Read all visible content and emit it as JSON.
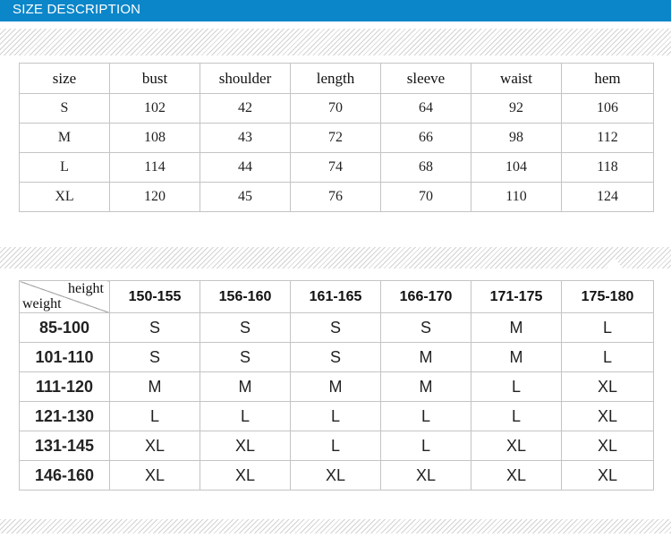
{
  "header": {
    "title": "SIZE DESCRIPTION",
    "bar_color": "#0b86c9"
  },
  "size_table": {
    "columns": [
      "size",
      "bust",
      "shoulder",
      "length",
      "sleeve",
      "waist",
      "hem"
    ],
    "rows": [
      [
        "S",
        "102",
        "42",
        "70",
        "64",
        "92",
        "106"
      ],
      [
        "M",
        "108",
        "43",
        "72",
        "66",
        "98",
        "112"
      ],
      [
        "L",
        "114",
        "44",
        "74",
        "68",
        "104",
        "118"
      ],
      [
        "XL",
        "120",
        "45",
        "76",
        "70",
        "110",
        "124"
      ]
    ]
  },
  "fit_table": {
    "corner_top": "height",
    "corner_bottom": "weight",
    "columns": [
      "150-155",
      "156-160",
      "161-165",
      "166-170",
      "171-175",
      "175-180"
    ],
    "rows": [
      {
        "weight": "85-100",
        "sizes": [
          "S",
          "S",
          "S",
          "S",
          "M",
          "L"
        ]
      },
      {
        "weight": "101-110",
        "sizes": [
          "S",
          "S",
          "S",
          "M",
          "M",
          "L"
        ]
      },
      {
        "weight": "111-120",
        "sizes": [
          "M",
          "M",
          "M",
          "M",
          "L",
          "XL"
        ]
      },
      {
        "weight": "121-130",
        "sizes": [
          "L",
          "L",
          "L",
          "L",
          "L",
          "XL"
        ]
      },
      {
        "weight": "131-145",
        "sizes": [
          "XL",
          "XL",
          "L",
          "L",
          "XL",
          "XL"
        ]
      },
      {
        "weight": "146-160",
        "sizes": [
          "XL",
          "XL",
          "XL",
          "XL",
          "XL",
          "XL"
        ]
      }
    ]
  }
}
